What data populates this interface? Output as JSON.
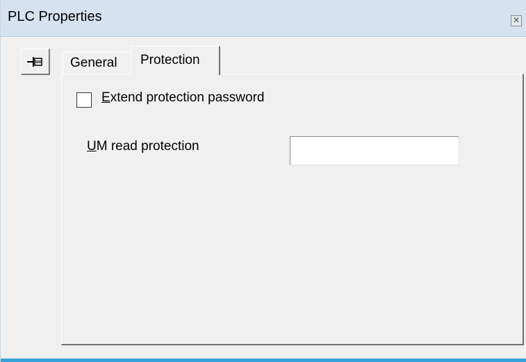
{
  "window": {
    "title": "PLC Properties",
    "close_icon": "close-icon"
  },
  "toolbar": {
    "pin_icon": "pin-icon"
  },
  "tabs": [
    {
      "label": "General",
      "active": false
    },
    {
      "label": "Protection",
      "active": true
    }
  ],
  "protection": {
    "extend_password": {
      "mnemonic": "E",
      "rest": "xtend protection password",
      "checked": false
    },
    "um_read": {
      "mnemonic": "U",
      "rest": "M read protection",
      "value": ""
    }
  },
  "colors": {
    "titlebar": "#d5e3f1",
    "window_bg": "#f0f0f0",
    "bottom_accent": "#36a2d8"
  }
}
